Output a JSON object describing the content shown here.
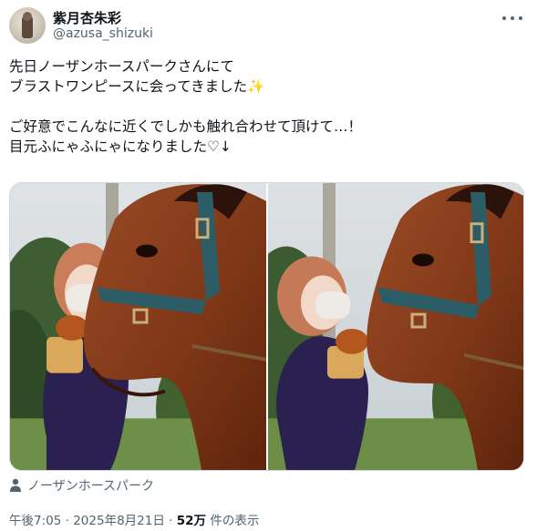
{
  "author": {
    "display_name": "紫月杏朱彩",
    "handle": "@azusa_shizuki",
    "avatar_icon": "profile-photo-avatar"
  },
  "tweet": {
    "lines": [
      "先日ノーザンホースパークさんにて",
      "ブラストワンピースに会ってきました",
      "",
      "ご好意でこんなに近くでしかも触れ合わせて頂けて…！",
      "目元ふにゃふにゃになりました♡↓"
    ],
    "sparkle_emoji": "✨"
  },
  "media": {
    "photos": [
      "photo-1",
      "photo-2"
    ]
  },
  "location": {
    "icon": "person-location-icon",
    "label": "ノーザンホースパーク"
  },
  "meta": {
    "time": "午後7:05",
    "separator": "·",
    "date": "2025年8月21日",
    "views_count": "52万",
    "views_label": "件の表示"
  },
  "colors": {
    "text_primary": "#0f1419",
    "text_secondary": "#536471",
    "border": "#cfd9de"
  }
}
